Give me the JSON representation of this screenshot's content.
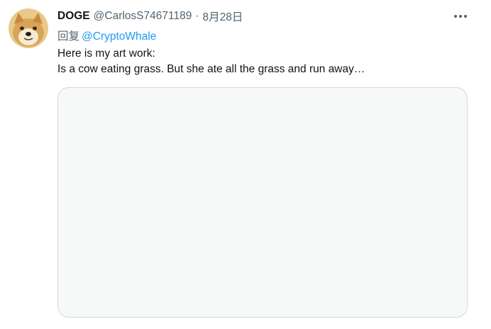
{
  "tweet": {
    "display_name": "DOGE",
    "handle": "@CarlosS74671189",
    "separator": "·",
    "date": "8月28日",
    "reply_prefix": "回复",
    "reply_to": "@CryptoWhale",
    "text_line_1": "Here is my art work:",
    "text_line_2": "Is a cow eating grass. But she ate all the grass and run away…",
    "more_icon": "more-horizontal-icon",
    "avatar_icon": "doge-avatar",
    "colors": {
      "link": "#1d9bf0",
      "secondary_text": "#536471",
      "primary_text": "#0f1419",
      "media_border": "#cfd9de",
      "media_background": "#f7f9f9"
    }
  }
}
